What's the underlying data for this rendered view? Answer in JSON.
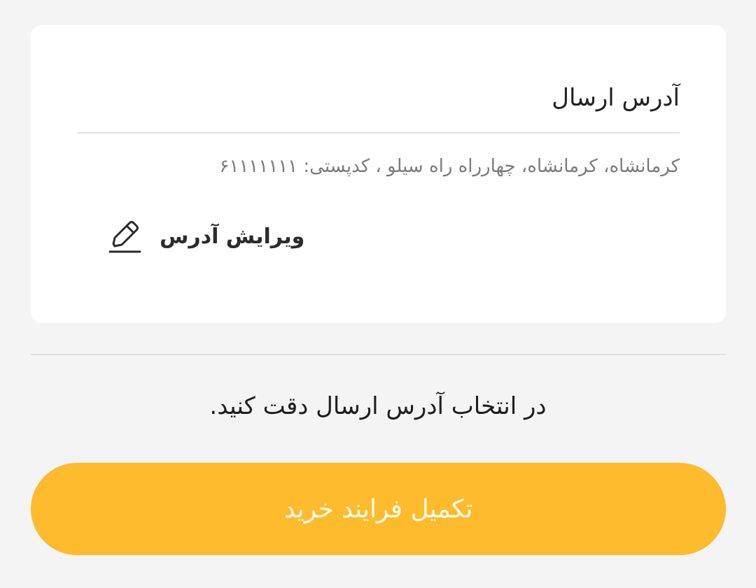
{
  "address_card": {
    "title": "آدرس ارسال",
    "address": "کرمانشاه، کرمانشاه، چهارراه راه سیلو ، کدپستی: ۶۱۱۱۱۱۱۱",
    "edit_label": "ویرایش آدرس",
    "edit_icon": "pencil-edit-icon"
  },
  "notice": "در انتخاب آدرس ارسال دقت کنید.",
  "cta": {
    "label": "تکمیل فرایند خرید"
  },
  "colors": {
    "background": "#f4f4f4",
    "card": "#ffffff",
    "accent": "#fdbb2d",
    "cta_text": "#fffbe8",
    "muted_text": "#7b7b7b"
  }
}
